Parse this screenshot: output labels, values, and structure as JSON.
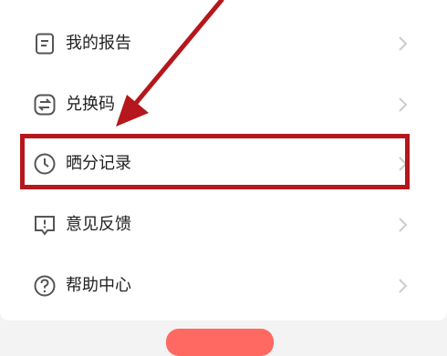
{
  "menu": {
    "items": [
      {
        "label": "我的报告",
        "icon": "report-icon"
      },
      {
        "label": "兑换码",
        "icon": "exchange-icon"
      },
      {
        "label": "晒分记录",
        "icon": "clock-icon"
      },
      {
        "label": "意见反馈",
        "icon": "feedback-icon"
      },
      {
        "label": "帮助中心",
        "icon": "help-icon"
      }
    ]
  },
  "colors": {
    "annotation_red": "#b5171c",
    "text": "#222222",
    "icon": "#555555",
    "chevron": "#cccccc",
    "accent_button": "#ff6961"
  }
}
